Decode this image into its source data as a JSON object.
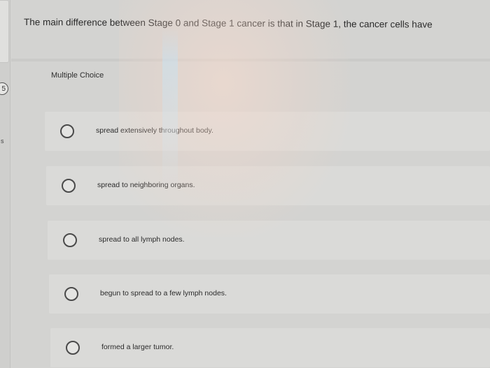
{
  "question": {
    "text": "The main difference between Stage 0 and Stage 1 cancer is that in Stage 1, the cancer cells have",
    "type_label": "Multiple Choice"
  },
  "sidebar": {
    "question_number": "5",
    "mark": "s"
  },
  "options": [
    {
      "label": "spread extensively throughout body."
    },
    {
      "label": "spread to neighboring organs."
    },
    {
      "label": "spread to all lymph nodes."
    },
    {
      "label": "begun to spread to a few lymph nodes."
    },
    {
      "label": "formed a larger tumor."
    }
  ],
  "colors": {
    "background": "#d3d3d1",
    "option_bg": "#dadad8",
    "radio_border": "#4a4a4a"
  }
}
